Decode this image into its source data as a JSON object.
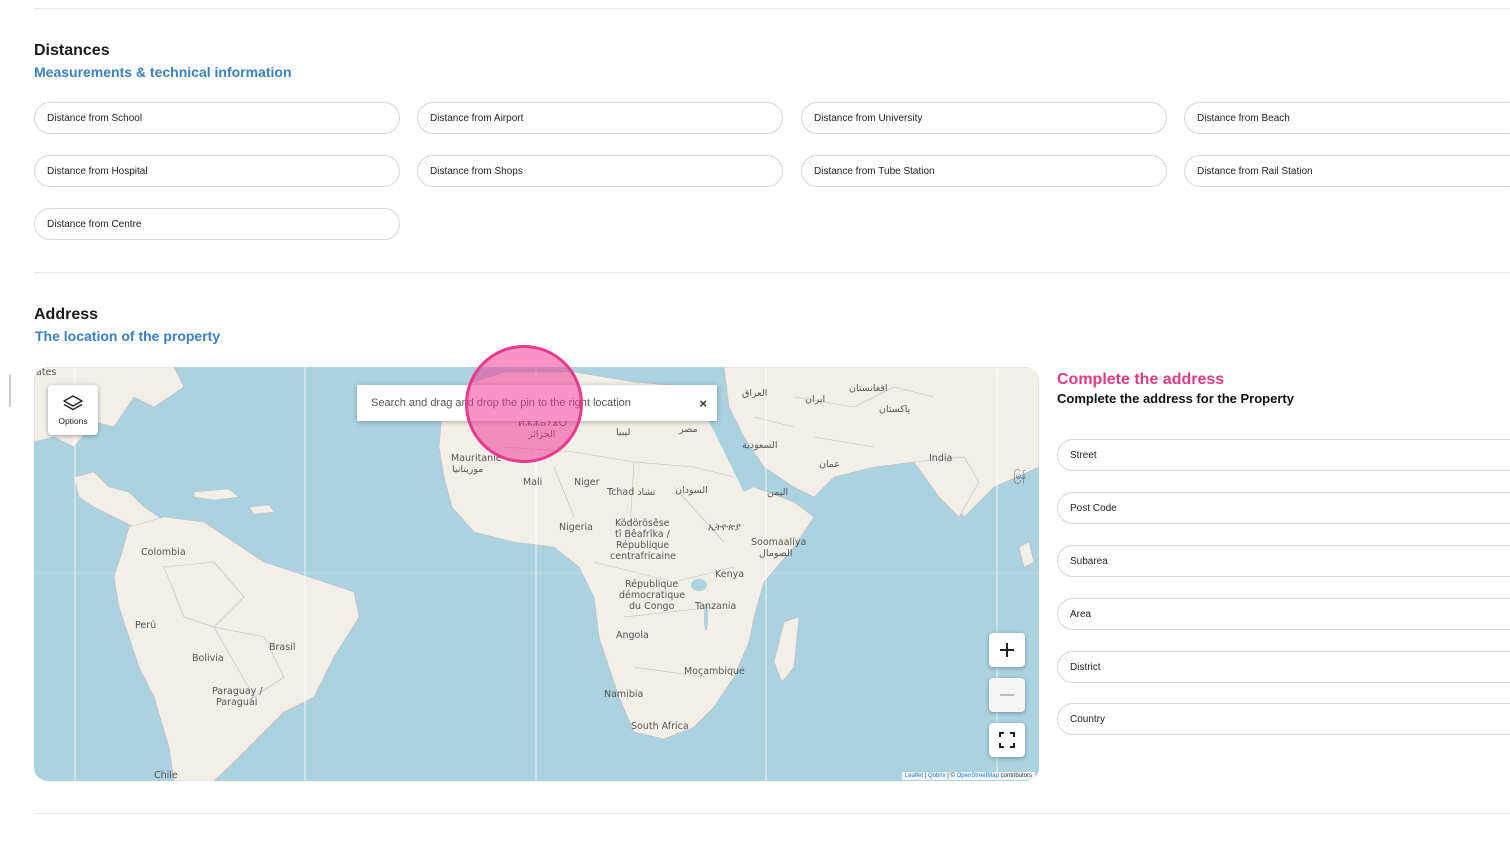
{
  "distances": {
    "title": "Distances",
    "subtitle": "Measurements & technical information",
    "fields": [
      {
        "placeholder": "Distance from School"
      },
      {
        "placeholder": "Distance from Airport"
      },
      {
        "placeholder": "Distance from University"
      },
      {
        "placeholder": "Distance from Beach"
      },
      {
        "placeholder": "Distance from Hospital"
      },
      {
        "placeholder": "Distance from Shops"
      },
      {
        "placeholder": "Distance from Tube Station"
      },
      {
        "placeholder": "Distance from Rail Station"
      },
      {
        "placeholder": "Distance from Centre"
      }
    ]
  },
  "address": {
    "title": "Address",
    "subtitle": "The location of the property"
  },
  "map": {
    "options_label": "Options",
    "search_placeholder": "Search and drag and drop the pin to the right location",
    "clear_symbol": "×",
    "zoom_in_symbol": "+",
    "zoom_out_symbol": "−",
    "attribution": {
      "leaflet": "Leaflet",
      "sep1": " | ",
      "qobrix": "Qobrix",
      "sep2": " | © ",
      "osm": "OpenStreetMap",
      "contributors": " contributors"
    },
    "labels": [
      "ates",
      "Mauritanie",
      "موريتانيا",
      "Mali",
      "Niger",
      "Tchad تشاد",
      "السودان",
      "ليبيا",
      "مصر",
      "ⵍⵣⵣⴰⵢⴻⵔ",
      "الجزائر",
      "العراق",
      "ایران",
      "افغانستان",
      "پاکستان",
      "السعودية",
      "عمان",
      "اليمن",
      "India",
      "Nigeria",
      "Ködörösêse",
      "tî Bêafrîka /",
      "République",
      "centrafricaine",
      "ኢትዮጵያ",
      "Soomaaliya",
      "الصومال",
      "Kenya",
      "République",
      "démocratique",
      "du Congo",
      "Tanzania",
      "Angola",
      "Moçambique",
      "Namibia",
      "South Africa",
      "Colombia",
      "Perú",
      "Brasil",
      "Bolivia",
      "Paraguay /",
      "Paraguái",
      "Chile",
      "မြန်"
    ]
  },
  "complete_address": {
    "title": "Complete the address",
    "subtitle": "Complete the address for the Property",
    "fields": [
      {
        "placeholder": "Street"
      },
      {
        "placeholder": "Post Code"
      },
      {
        "placeholder": "Subarea"
      },
      {
        "placeholder": "Area"
      },
      {
        "placeholder": "District"
      },
      {
        "placeholder": "Country"
      }
    ]
  },
  "colors": {
    "accent_blue": "#3a7fc1",
    "accent_pink": "#e03a82",
    "water": "#aad3df",
    "land": "#f2efe9"
  }
}
